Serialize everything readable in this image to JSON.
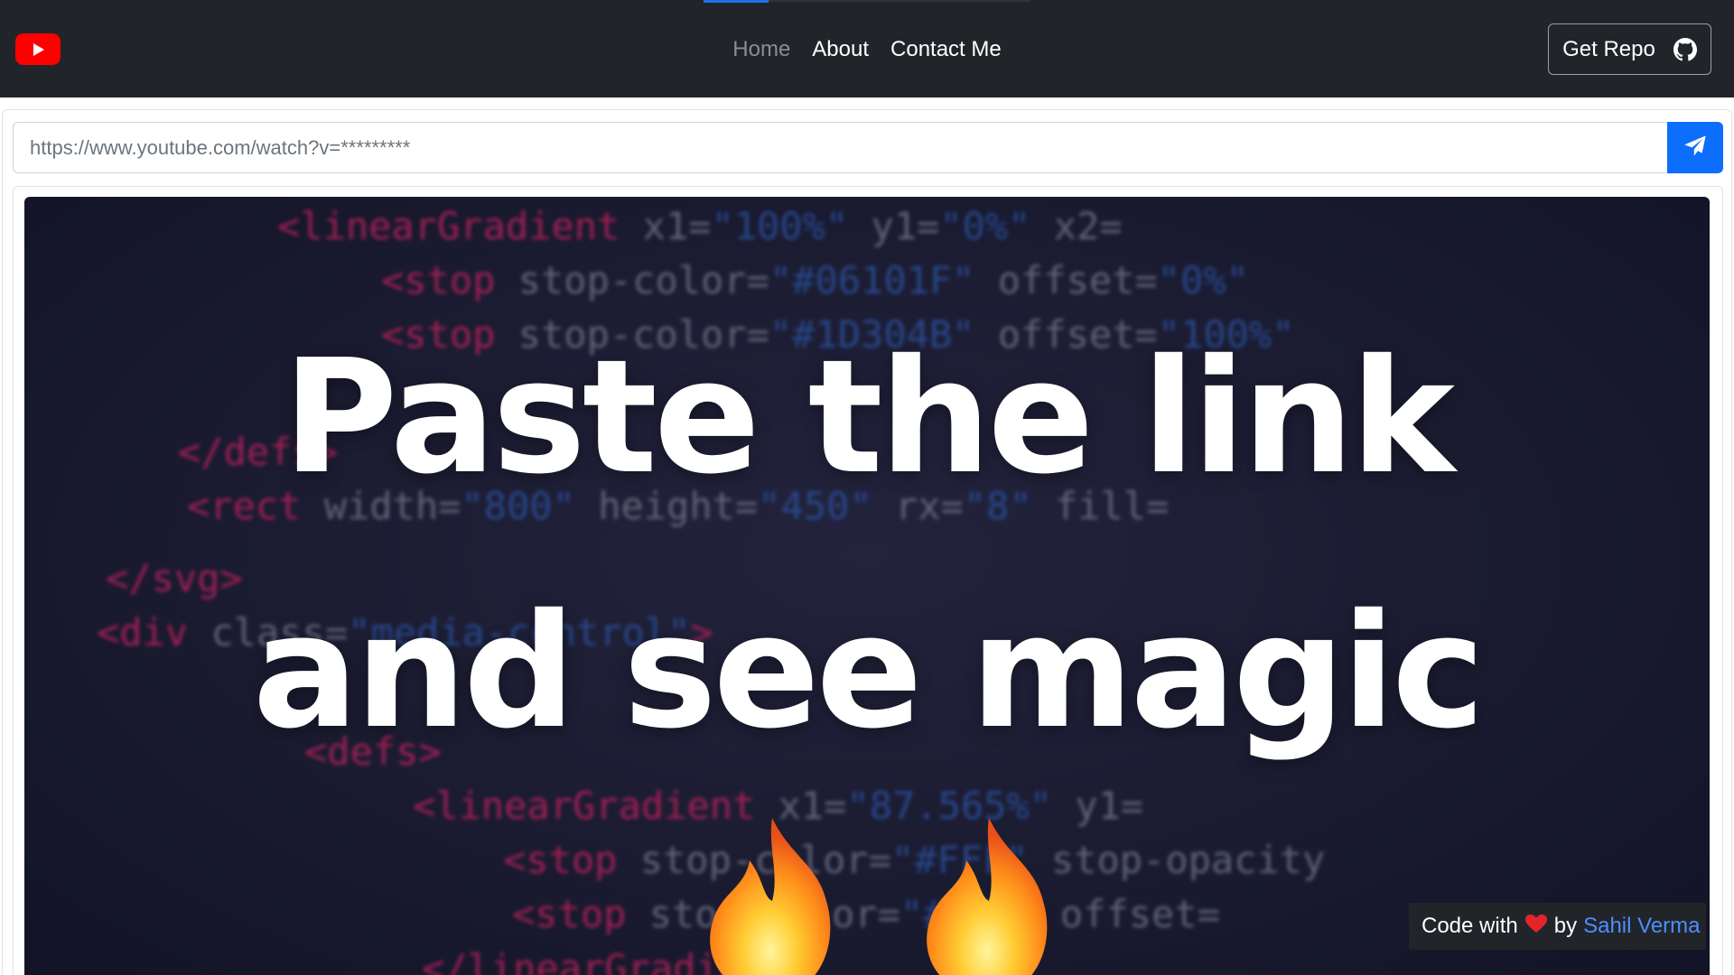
{
  "navbar": {
    "logo_icon": "youtube-logo-icon",
    "links": [
      {
        "label": "Home",
        "state": "inactive"
      },
      {
        "label": "About",
        "state": "active"
      },
      {
        "label": "Contact Me",
        "state": "active"
      }
    ],
    "repo_button": {
      "label": "Get Repo",
      "icon": "github-icon"
    }
  },
  "search": {
    "placeholder": "https://www.youtube.com/watch?v=*********",
    "value": "",
    "submit_icon": "paper-plane-icon"
  },
  "hero": {
    "line1": "Paste the link",
    "line2": "and see magic",
    "decorations": [
      "fire-emoji",
      "fire-emoji"
    ]
  },
  "credit": {
    "prefix": "Code with",
    "heart_icon": "heart-icon",
    "middle": "by",
    "author": "Sahil Verma"
  },
  "colors": {
    "navbar_bg": "#212529",
    "accent_blue": "#0d6efd",
    "link_blue": "#4f8dff",
    "youtube_red": "#ff0000"
  }
}
